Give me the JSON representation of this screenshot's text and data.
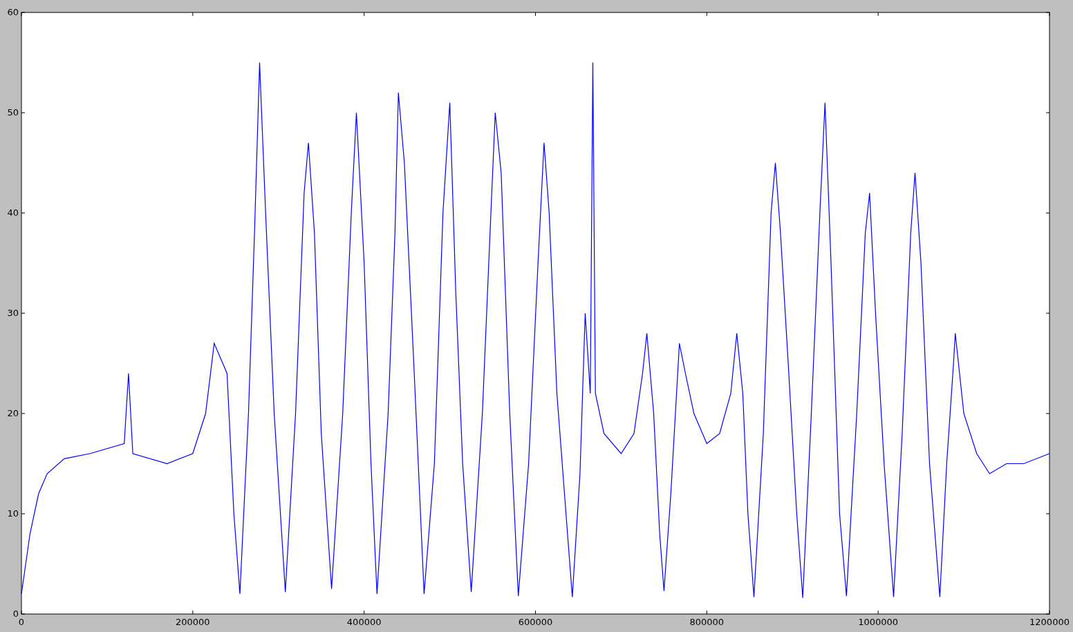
{
  "figure": {
    "chart_data": {
      "type": "line",
      "xlim": [
        0,
        1200000
      ],
      "ylim": [
        0,
        60
      ],
      "xticks": [
        0,
        200000,
        400000,
        600000,
        800000,
        1000000,
        1200000
      ],
      "yticks": [
        0,
        10,
        20,
        30,
        40,
        50,
        60
      ],
      "x": [
        0,
        10000,
        20000,
        30000,
        50000,
        80000,
        120000,
        125000,
        130000,
        170000,
        200000,
        215000,
        225000,
        240000,
        248000,
        255000,
        265000,
        272000,
        278000,
        285000,
        295000,
        308000,
        320000,
        330000,
        335000,
        342000,
        350000,
        362000,
        375000,
        385000,
        391000,
        400000,
        408000,
        415000,
        428000,
        436000,
        440000,
        447000,
        458000,
        470000,
        482000,
        492000,
        500000,
        507000,
        515000,
        525000,
        538000,
        547000,
        553000,
        560000,
        570000,
        580000,
        592000,
        603000,
        610000,
        616000,
        625000,
        643000,
        652000,
        658000,
        664000,
        667000,
        670000,
        680000,
        700000,
        715000,
        725000,
        730000,
        738000,
        745000,
        750000,
        758000,
        768000,
        775000,
        785000,
        800000,
        815000,
        828000,
        835000,
        842000,
        848000,
        855000,
        866000,
        875000,
        880000,
        886000,
        895000,
        905000,
        912000,
        922000,
        932000,
        938000,
        945000,
        955000,
        963000,
        975000,
        985000,
        990000,
        997000,
        1007000,
        1018000,
        1028000,
        1038000,
        1043000,
        1050000,
        1060000,
        1072000,
        1080000,
        1088000,
        1090000,
        1100000,
        1115000,
        1130000,
        1150000,
        1170000,
        1200000
      ],
      "series": [
        {
          "color": "#0000ff",
          "values": [
            2,
            8,
            12,
            14,
            15.5,
            16,
            17,
            24,
            16,
            15,
            16,
            20,
            27,
            24,
            10,
            2,
            20,
            38,
            55,
            40,
            20,
            2.2,
            20,
            42,
            47,
            38,
            18,
            2.5,
            20,
            40,
            50,
            35,
            15,
            2,
            20,
            38,
            52,
            45,
            25,
            2,
            15,
            40,
            51,
            32,
            15,
            2.2,
            20,
            38,
            50,
            44,
            20,
            1.8,
            15,
            35,
            47,
            40,
            22,
            1.7,
            14,
            30,
            22,
            55,
            22,
            18,
            16,
            18,
            24,
            28,
            20,
            8,
            2.3,
            12,
            27,
            24,
            20,
            17,
            18,
            22,
            28,
            22,
            10,
            1.7,
            18,
            40,
            45,
            38,
            25,
            10,
            1.6,
            20,
            40,
            51,
            35,
            10,
            1.8,
            20,
            38,
            42,
            30,
            15,
            1.7,
            18,
            38,
            44,
            35,
            15,
            1.7,
            15,
            25,
            28,
            20,
            16,
            14,
            15,
            15,
            16
          ]
        }
      ]
    }
  }
}
